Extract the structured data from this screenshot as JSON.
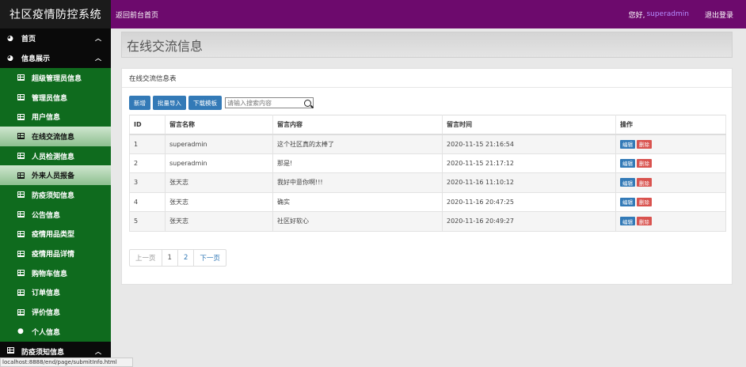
{
  "header": {
    "brand": "社区疫情防控系统",
    "back_link": "返回前台首页",
    "greeting": "您好,",
    "username": "superadmin",
    "logout": "退出登录"
  },
  "sidebar": {
    "groups": [
      {
        "label": "首页",
        "icon": "dashboard-icon"
      },
      {
        "label": "信息展示",
        "icon": "dashboard-icon"
      }
    ],
    "items": [
      {
        "label": "超级管理员信息",
        "icon": "table-icon"
      },
      {
        "label": "管理员信息",
        "icon": "table-icon"
      },
      {
        "label": "用户信息",
        "icon": "table-icon"
      },
      {
        "label": "在线交流信息",
        "icon": "table-icon",
        "active": true
      },
      {
        "label": "人员检测信息",
        "icon": "table-icon"
      },
      {
        "label": "外来人员报备",
        "icon": "table-icon",
        "active": true
      },
      {
        "label": "防疫须知信息",
        "icon": "table-icon"
      },
      {
        "label": "公告信息",
        "icon": "table-icon"
      },
      {
        "label": "疫情用品类型",
        "icon": "table-icon"
      },
      {
        "label": "疫情用品详情",
        "icon": "table-icon"
      },
      {
        "label": "购物车信息",
        "icon": "table-icon"
      },
      {
        "label": "订单信息",
        "icon": "table-icon"
      },
      {
        "label": "评价信息",
        "icon": "table-icon"
      },
      {
        "label": "个人信息",
        "icon": "user-icon"
      }
    ],
    "bottom_group": {
      "label": "防疫须知信息",
      "icon": "table-icon"
    }
  },
  "status_url": "localhost:8888/end/page/submitInfo.html",
  "page_title": "在线交流信息",
  "panel": {
    "title": "在线交流信息表",
    "buttons": {
      "add": "新增",
      "import": "批量导入",
      "template": "下载模板"
    },
    "search_placeholder": "请输入搜索内容"
  },
  "table": {
    "columns": [
      "ID",
      "留言名称",
      "留言内容",
      "留言时间",
      "操作"
    ],
    "rows": [
      {
        "id": "1",
        "name": "superadmin",
        "content": "这个社区真的太棒了",
        "time": "2020-11-15 21:16:54"
      },
      {
        "id": "2",
        "name": "superadmin",
        "content": "那是!",
        "time": "2020-11-15 21:17:12"
      },
      {
        "id": "3",
        "name": "张天志",
        "content": "我好中意你啊!!!",
        "time": "2020-11-16 11:10:12"
      },
      {
        "id": "4",
        "name": "张天志",
        "content": "确实",
        "time": "2020-11-16 20:47:25"
      },
      {
        "id": "5",
        "name": "张天志",
        "content": "社区好软心",
        "time": "2020-11-16 20:49:27"
      }
    ],
    "edit_label": "编辑",
    "delete_label": "删除"
  },
  "pagination": {
    "prev": "上一页",
    "pages": [
      "1",
      "2"
    ],
    "next": "下一页"
  },
  "colors": {
    "topbar": "#6d0a6d",
    "sidebar": "#0f6b1e",
    "primary": "#337ab7",
    "danger": "#d9534f"
  }
}
